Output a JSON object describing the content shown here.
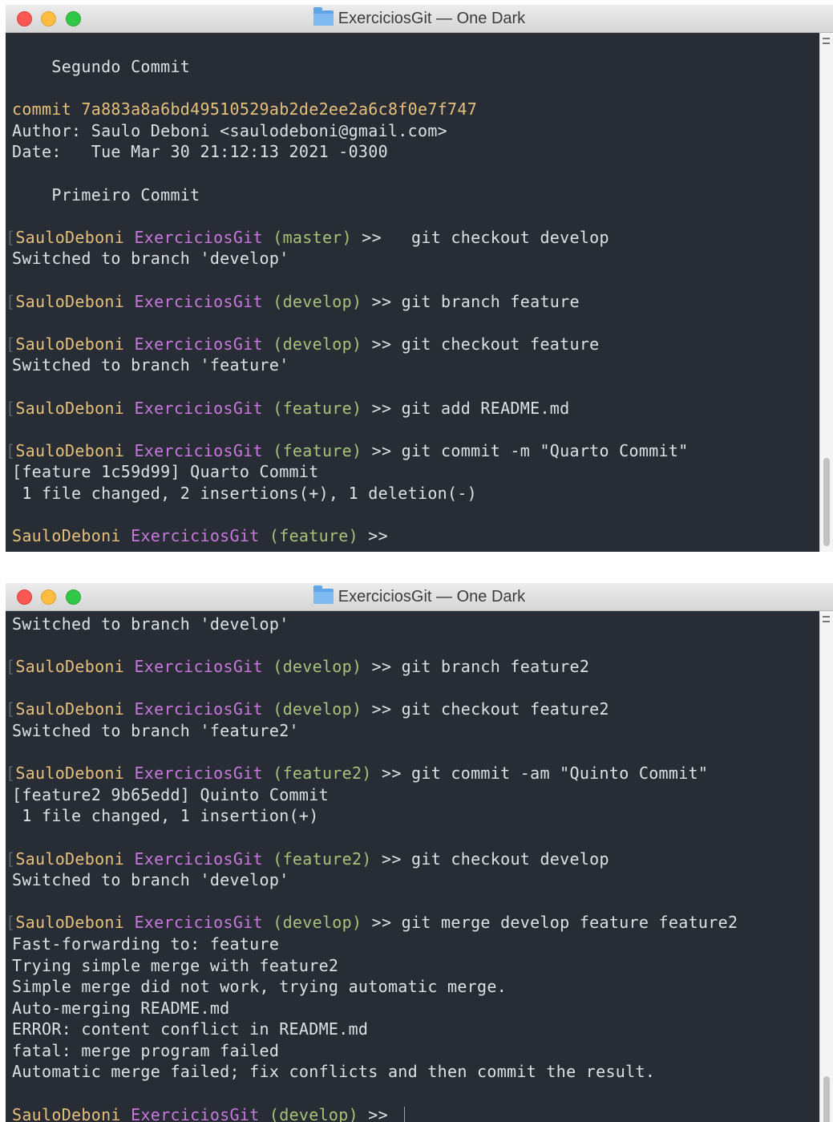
{
  "windows": [
    {
      "title": "ExerciciosGit — One Dark",
      "lines": [
        {
          "type": "text",
          "text": "    Segundo Commit"
        },
        {
          "type": "blank"
        },
        {
          "type": "commit",
          "label": "commit ",
          "hash": "7a883a8a6bd49510529ab2de2ee2a6c8f0e7f747"
        },
        {
          "type": "text",
          "text": "Author: Saulo Deboni <saulodeboni@gmail.com>"
        },
        {
          "type": "text",
          "text": "Date:   Tue Mar 30 21:12:13 2021 -0300"
        },
        {
          "type": "blank"
        },
        {
          "type": "text",
          "text": "    Primeiro Commit"
        },
        {
          "type": "blank"
        },
        {
          "type": "prompt",
          "user": "SauloDeboni",
          "dir": "ExerciciosGit",
          "branch": "(master)",
          "arrow": " >>",
          "cmd": "   git checkout develop",
          "bracket": true
        },
        {
          "type": "text",
          "text": "Switched to branch 'develop'"
        },
        {
          "type": "blank"
        },
        {
          "type": "prompt",
          "user": "SauloDeboni",
          "dir": "ExerciciosGit",
          "branch": "(develop)",
          "arrow": " >>",
          "cmd": " git branch feature",
          "bracket": true
        },
        {
          "type": "blank"
        },
        {
          "type": "prompt",
          "user": "SauloDeboni",
          "dir": "ExerciciosGit",
          "branch": "(develop)",
          "arrow": " >>",
          "cmd": " git checkout feature",
          "bracket": true
        },
        {
          "type": "text",
          "text": "Switched to branch 'feature'"
        },
        {
          "type": "blank"
        },
        {
          "type": "prompt",
          "user": "SauloDeboni",
          "dir": "ExerciciosGit",
          "branch": "(feature)",
          "arrow": " >>",
          "cmd": " git add README.md",
          "bracket": true
        },
        {
          "type": "blank"
        },
        {
          "type": "prompt",
          "user": "SauloDeboni",
          "dir": "ExerciciosGit",
          "branch": "(feature)",
          "arrow": " >>",
          "cmd": " git commit -m \"Quarto Commit\"",
          "bracket": true
        },
        {
          "type": "text",
          "text": "[feature 1c59d99] Quarto Commit"
        },
        {
          "type": "text",
          "text": " 1 file changed, 2 insertions(+), 1 deletion(-)"
        },
        {
          "type": "blank"
        },
        {
          "type": "prompt",
          "user": "SauloDeboni",
          "dir": "ExerciciosGit",
          "branch": "(feature)",
          "arrow": " >>",
          "cmd": "",
          "bracket": false
        }
      ]
    },
    {
      "title": "ExerciciosGit — One Dark",
      "lines": [
        {
          "type": "text",
          "text": "Switched to branch 'develop'"
        },
        {
          "type": "blank"
        },
        {
          "type": "prompt",
          "user": "SauloDeboni",
          "dir": "ExerciciosGit",
          "branch": "(develop)",
          "arrow": " >>",
          "cmd": " git branch feature2",
          "bracket": true
        },
        {
          "type": "blank"
        },
        {
          "type": "prompt",
          "user": "SauloDeboni",
          "dir": "ExerciciosGit",
          "branch": "(develop)",
          "arrow": " >>",
          "cmd": " git checkout feature2",
          "bracket": true
        },
        {
          "type": "text",
          "text": "Switched to branch 'feature2'"
        },
        {
          "type": "blank"
        },
        {
          "type": "prompt",
          "user": "SauloDeboni",
          "dir": "ExerciciosGit",
          "branch": "(feature2)",
          "arrow": " >>",
          "cmd": " git commit -am \"Quinto Commit\"",
          "bracket": true
        },
        {
          "type": "text",
          "text": "[feature2 9b65edd] Quinto Commit"
        },
        {
          "type": "text",
          "text": " 1 file changed, 1 insertion(+)"
        },
        {
          "type": "blank"
        },
        {
          "type": "prompt",
          "user": "SauloDeboni",
          "dir": "ExerciciosGit",
          "branch": "(feature2)",
          "arrow": " >>",
          "cmd": " git checkout develop",
          "bracket": true
        },
        {
          "type": "text",
          "text": "Switched to branch 'develop'"
        },
        {
          "type": "blank"
        },
        {
          "type": "prompt",
          "user": "SauloDeboni",
          "dir": "ExerciciosGit",
          "branch": "(develop)",
          "arrow": " >>",
          "cmd": " git merge develop feature feature2",
          "bracket": true
        },
        {
          "type": "text",
          "text": "Fast-forwarding to: feature"
        },
        {
          "type": "text",
          "text": "Trying simple merge with feature2"
        },
        {
          "type": "text",
          "text": "Simple merge did not work, trying automatic merge."
        },
        {
          "type": "text",
          "text": "Auto-merging README.md"
        },
        {
          "type": "text",
          "text": "ERROR: content conflict in README.md"
        },
        {
          "type": "text",
          "text": "fatal: merge program failed"
        },
        {
          "type": "text",
          "text": "Automatic merge failed; fix conflicts and then commit the result."
        },
        {
          "type": "blank"
        },
        {
          "type": "prompt",
          "user": "SauloDeboni",
          "dir": "ExerciciosGit",
          "branch": "(develop)",
          "arrow": " >>",
          "cmd": "",
          "bracket": false,
          "cursor": true
        }
      ]
    }
  ],
  "colors": {
    "background": "#282c34",
    "user": "#e5c07b",
    "directory": "#c678dd",
    "branch": "#a8c279",
    "commit_hash": "#e5c07b",
    "text": "#dde1e6"
  },
  "icons": {
    "title_icon": "folder-icon",
    "traffic_lights": [
      "close-button",
      "minimize-button",
      "zoom-button"
    ]
  }
}
